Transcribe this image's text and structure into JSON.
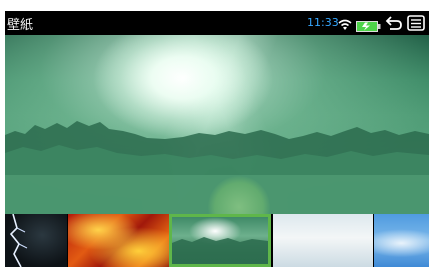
{
  "statusbar": {
    "title": "壁紙",
    "time": "11:33",
    "icons": [
      "wifi-icon",
      "battery-charging-icon",
      "back-icon",
      "menu-icon"
    ]
  },
  "preview": {
    "wallpaper": "forest-light-rays"
  },
  "thumbnails": [
    {
      "name": "lightning"
    },
    {
      "name": "fire"
    },
    {
      "name": "forest",
      "selected": true
    },
    {
      "name": "clouds"
    },
    {
      "name": "sky"
    }
  ],
  "colors": {
    "time": "#36a7ff",
    "selection": "#5fb64a",
    "battery": "#4ed34a"
  }
}
